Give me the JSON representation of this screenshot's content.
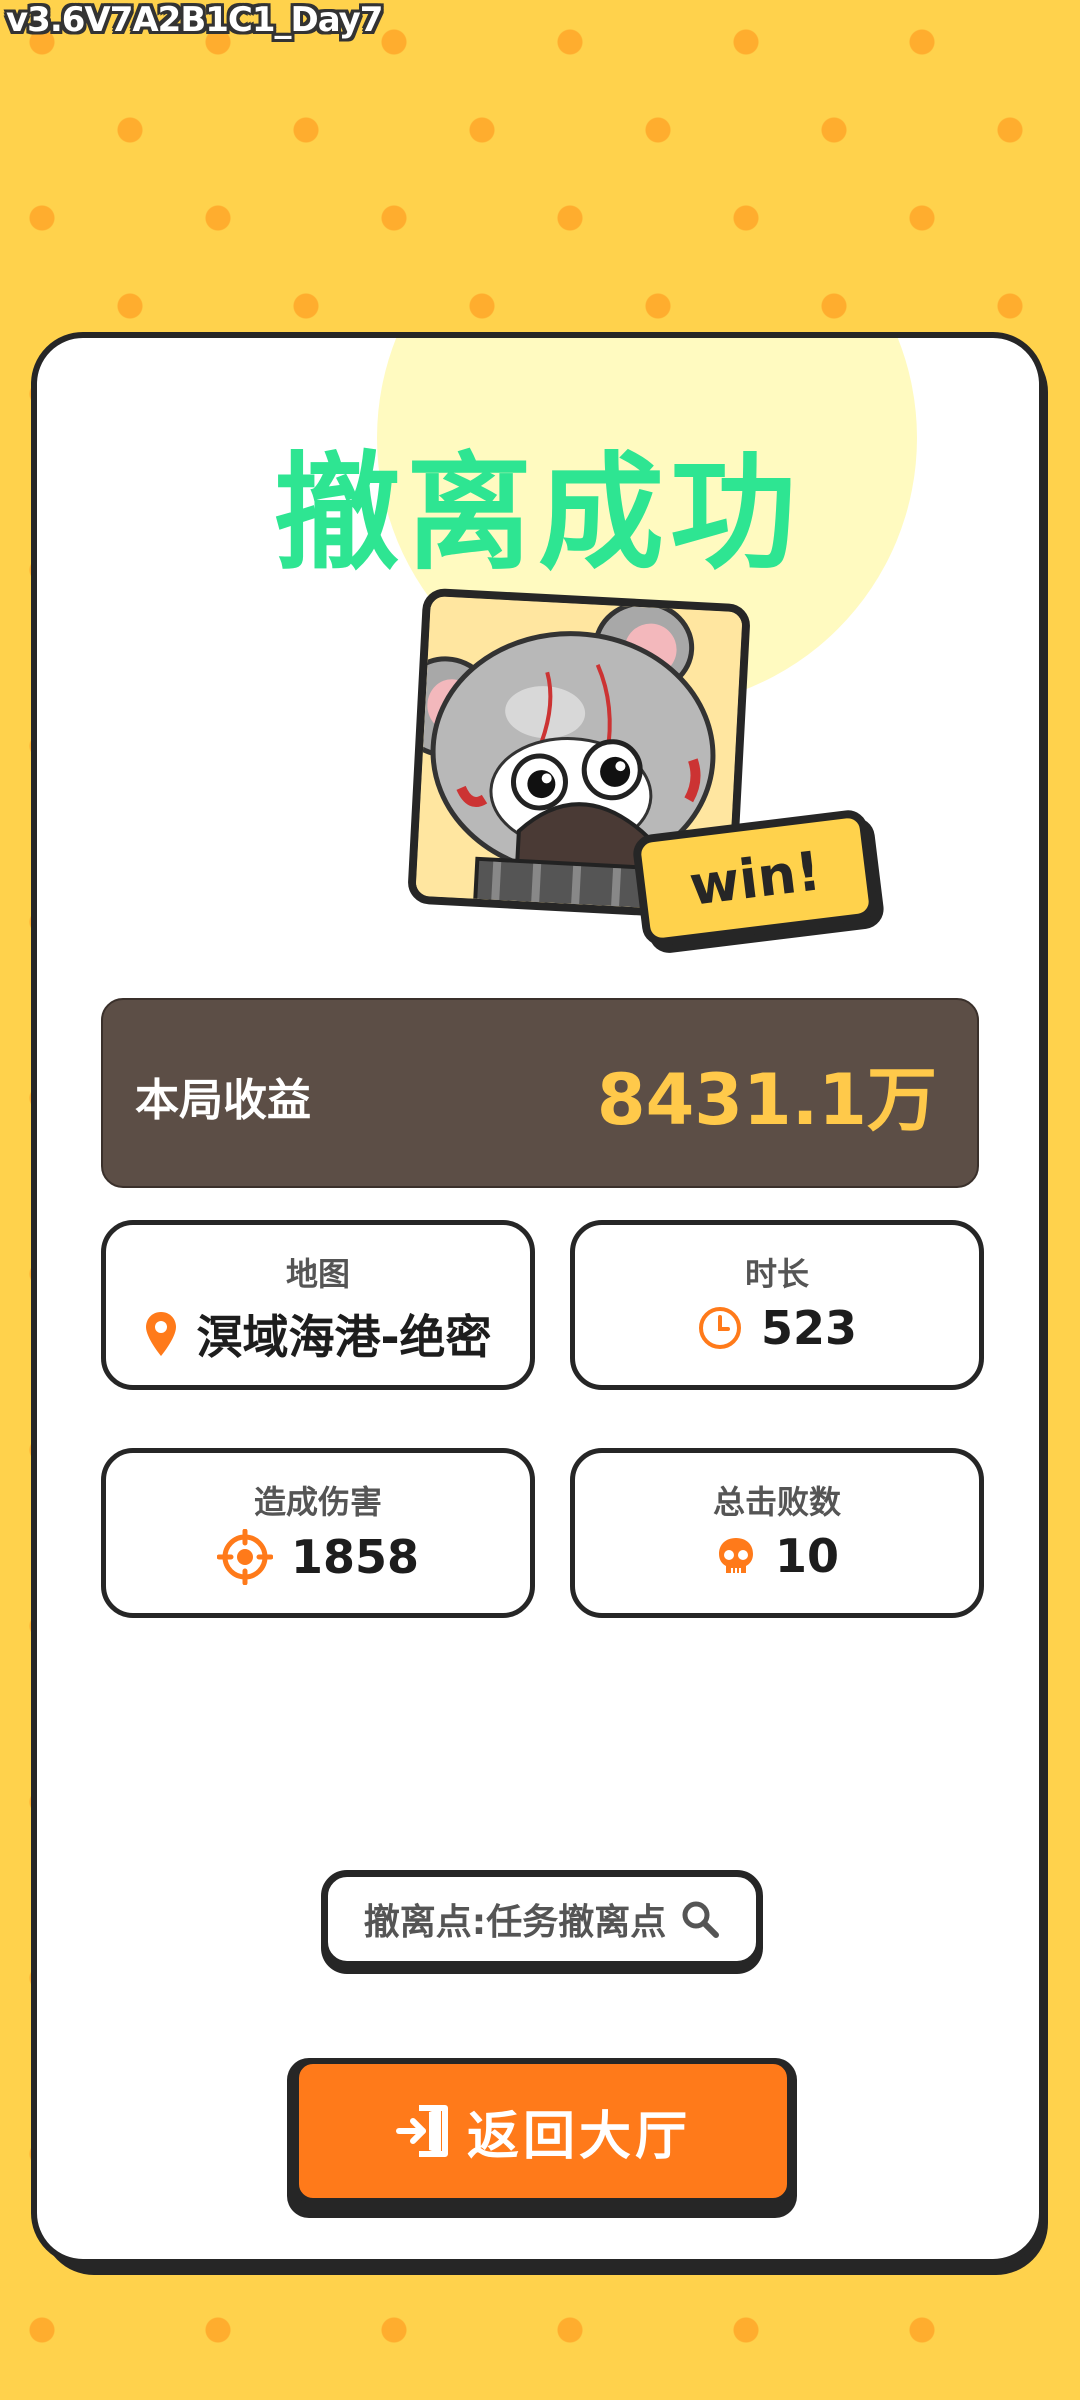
{
  "version_label": "v3.6V7A2B1C1_Day7",
  "result": {
    "title": "撤离成功",
    "badge": "win!"
  },
  "earnings": {
    "label": "本局收益",
    "value": "8431.1万"
  },
  "stats": {
    "map": {
      "label": "地图",
      "value": "溟域海港-绝密",
      "icon": "location-pin-icon"
    },
    "duration": {
      "label": "时长",
      "value": "523",
      "icon": "clock-icon"
    },
    "damage": {
      "label": "造成伤害",
      "value": "1858",
      "icon": "crosshair-icon"
    },
    "kills": {
      "label": "总击败数",
      "value": "10",
      "icon": "skull-icon"
    }
  },
  "extraction": {
    "text": "撤离点:任务撤离点",
    "icon": "search-icon"
  },
  "return_button": {
    "label": "返回大厅",
    "icon": "exit-door-icon"
  },
  "colors": {
    "background": "#ffd24c",
    "title": "#2ee592",
    "earnings_bg": "#5c4e46",
    "earnings_value": "#ffc94a",
    "accent_orange": "#ff7a1a",
    "outline": "#262626"
  }
}
